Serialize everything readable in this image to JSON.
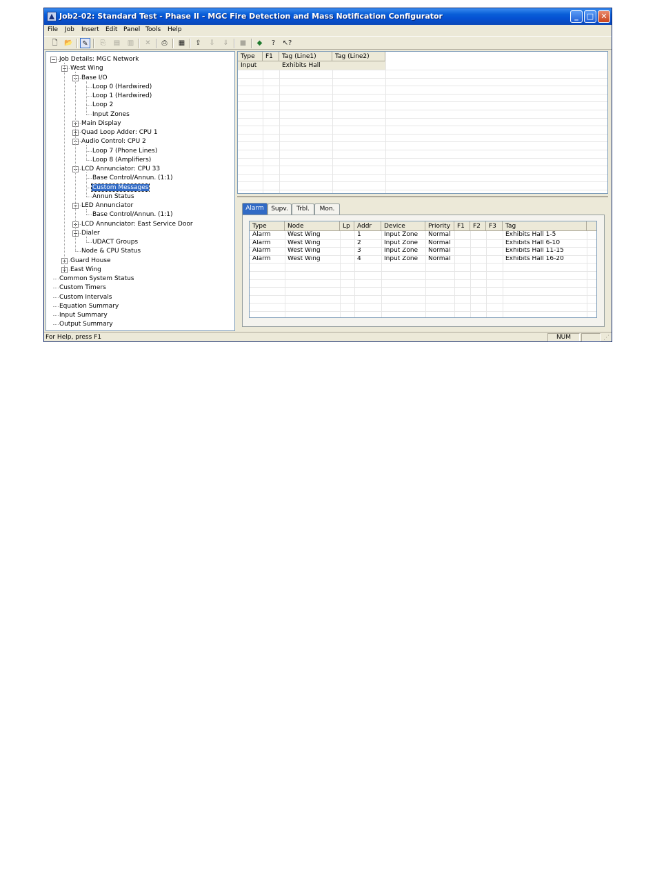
{
  "window": {
    "title": "Job2-02: Standard Test - Phase II - MGC Fire Detection and Mass Notification Configurator",
    "buttons": {
      "minimize": "_",
      "maximize": "□",
      "close": "✕"
    }
  },
  "menu": [
    "File",
    "Job",
    "Insert",
    "Edit",
    "Panel",
    "Tools",
    "Help"
  ],
  "toolbar": {
    "icons": [
      "new-icon",
      "open-icon",
      "edit-pen-icon",
      "copy-icon",
      "paste-icon",
      "paste-special-icon",
      "delete-icon",
      "print-icon",
      "report-icon",
      "upload-icon",
      "download-icon",
      "download-all-icon",
      "panel-icon",
      "globe-icon",
      "help-icon",
      "context-help-icon"
    ]
  },
  "tree": [
    {
      "label": "Job Details: MGC Network",
      "toggle": "−"
    },
    {
      "label": "West Wing",
      "toggle": "−"
    },
    {
      "label": "Base I/O",
      "toggle": "−"
    },
    {
      "label": "Loop 0  (Hardwired)"
    },
    {
      "label": "Loop 1  (Hardwired)"
    },
    {
      "label": "Loop 2"
    },
    {
      "label": "Input Zones"
    },
    {
      "label": "Main Display",
      "toggle": "+"
    },
    {
      "label": "Quad Loop Adder: CPU 1",
      "toggle": "+"
    },
    {
      "label": "Audio Control: CPU 2",
      "toggle": "−"
    },
    {
      "label": "Loop 7  (Phone Lines)"
    },
    {
      "label": "Loop 8  (Amplifiers)"
    },
    {
      "label": "LCD Annunciator: CPU 33",
      "toggle": "−"
    },
    {
      "label": "Base Control/Annun. (1:1)"
    },
    {
      "label": "Custom Messages",
      "selected": true
    },
    {
      "label": "Annun Status"
    },
    {
      "label": "LED Annunciator",
      "toggle": "−"
    },
    {
      "label": "Base Control/Annun. (1:1)"
    },
    {
      "label": "LCD Annunciator: East Service Door",
      "toggle": "+"
    },
    {
      "label": "Dialer",
      "toggle": "−"
    },
    {
      "label": "UDACT Groups"
    },
    {
      "label": "Node & CPU Status"
    },
    {
      "label": "Guard House",
      "toggle": "+"
    },
    {
      "label": "East Wing",
      "toggle": "+"
    },
    {
      "label": "Common System Status"
    },
    {
      "label": "Custom Timers"
    },
    {
      "label": "Custom Intervals"
    },
    {
      "label": "Equation Summary"
    },
    {
      "label": "Input Summary"
    },
    {
      "label": "Output Summary"
    }
  ],
  "upper_table": {
    "columns": [
      "Type",
      "F1",
      "Tag (Line1)",
      "Tag (Line2)"
    ],
    "rows": [
      [
        "Input",
        "",
        "Exhibits Hall",
        ""
      ]
    ]
  },
  "tabs": [
    "Alarm",
    "Supv.",
    "Trbl.",
    "Mon."
  ],
  "lower_table": {
    "columns": [
      "Type",
      "Node",
      "Lp",
      "Addr",
      "Device",
      "Priority",
      "F1",
      "F2",
      "F3",
      "Tag"
    ],
    "rows": [
      [
        "Alarm",
        "West Wing",
        "",
        "1",
        "Input Zone",
        "Normal",
        "",
        "",
        "",
        "Exhibits Hall 1-5"
      ],
      [
        "Alarm",
        "West Wing",
        "",
        "2",
        "Input Zone",
        "Normal",
        "",
        "",
        "",
        "Exhibits Hall 6-10"
      ],
      [
        "Alarm",
        "West Wing",
        "",
        "3",
        "Input Zone",
        "Normal",
        "",
        "",
        "",
        "Exhibits Hall 11-15"
      ],
      [
        "Alarm",
        "West Wing",
        "",
        "4",
        "Input Zone",
        "Normal",
        "",
        "",
        "",
        "Exhibits Hall 16-20"
      ]
    ]
  },
  "status": {
    "help": "For Help, press F1",
    "num": "NUM",
    "grip": "⋰"
  }
}
